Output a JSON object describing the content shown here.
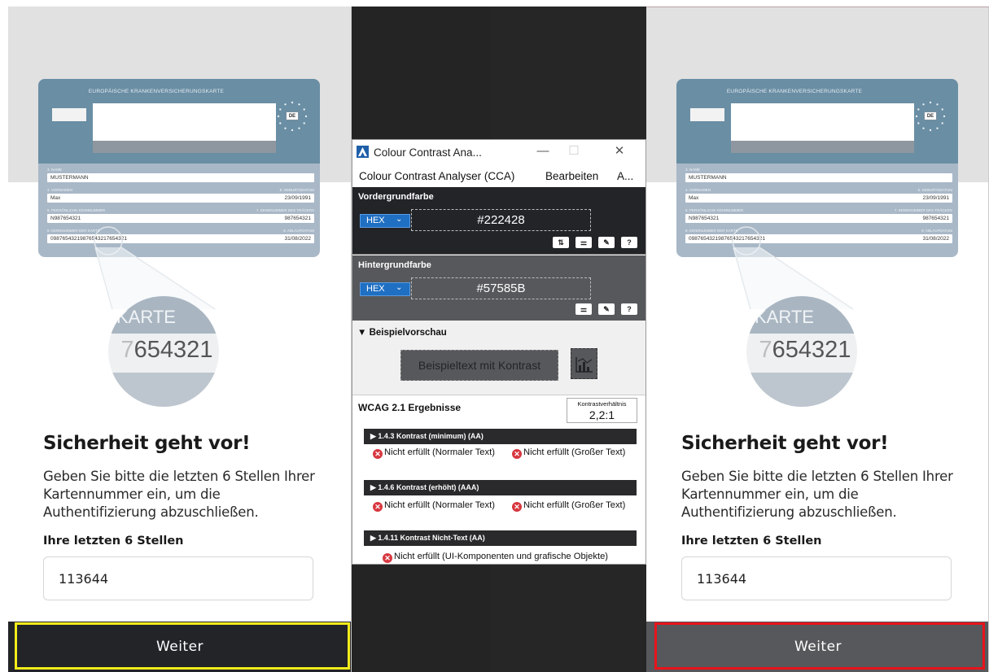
{
  "phone": {
    "card": {
      "header": "EUROPÄISCHE KRANKENVERSICHERUNGSKARTE",
      "country": "DE",
      "fields": [
        {
          "label": "3. NAME",
          "label_right": "",
          "value": "MUSTERMANN",
          "value_right": ""
        },
        {
          "label": "4. VORNAMEN",
          "label_right": "5. GEBURTSDATUM",
          "value": "Max",
          "value_right": "23/09/1991"
        },
        {
          "label": "6. PERSÖNLICHE KENNNUMMER",
          "label_right": "7. KENNNUMMER DES TRÄGERS",
          "value": "N987654321",
          "value_right": "987654321"
        },
        {
          "label": "8. KENNNUMMER DER KARTE",
          "label_right": "9. ABLAUFDATUM",
          "value": "09876543219876543217654321",
          "value_right": "31/08/2022"
        }
      ]
    },
    "magnifier": {
      "top_text": "KARTE",
      "number_faded": "7",
      "number": "654321"
    },
    "heading": "Sicherheit geht vor!",
    "description": "Geben Sie bitte die letzten 6 Stellen Ihrer Kartennummer ein, um die Authentifizierung abzuschließen.",
    "input_label": "Ihre letzten 6 Stellen",
    "input_value": "113644",
    "button_label": "Weiter"
  },
  "colors": {
    "left_button": "#222428",
    "right_button": "#57585B",
    "highlight_left": "#f2ec1b",
    "highlight_right": "#e8141b"
  },
  "cca": {
    "window_title": "Colour Contrast Ana...",
    "window_buttons": [
      "—",
      "☐",
      "✕"
    ],
    "menu": [
      "Colour Contrast Analyser (CCA)",
      "Bearbeiten",
      "A..."
    ],
    "foreground": {
      "title": "Vordergrundfarbe",
      "format": "HEX",
      "value": "#222428",
      "tools": [
        "swap-icon",
        "sliders-icon",
        "eyedropper-icon",
        "help-icon"
      ]
    },
    "background": {
      "title": "Hintergrundfarbe",
      "format": "HEX",
      "value": "#57585B",
      "tools": [
        "sliders-icon",
        "eyedropper-icon",
        "help-icon"
      ]
    },
    "preview": {
      "title": "▼ Beispielvorschau",
      "sample_text": "Beispieltext mit Kontrast"
    },
    "results": {
      "title": "WCAG 2.1 Ergebnisse",
      "ratio_label": "Kontrastverhältnis",
      "ratio_value": "2,2:1",
      "criteria": [
        {
          "title": "▶  1.4.3 Kontrast (minimum) (AA)",
          "r1": "Nicht erfüllt (Normaler Text)",
          "r2": "Nicht erfüllt (Großer Text)"
        },
        {
          "title": "▶  1.4.6 Kontrast (erhöht) (AAA)",
          "r1": "Nicht erfüllt (Normaler Text)",
          "r2": "Nicht erfüllt (Großer Text)"
        },
        {
          "title": "▶  1.4.11 Kontrast Nicht-Text (AA)",
          "r1": "Nicht erfüllt (UI-Komponenten und grafische Objekte)"
        }
      ]
    }
  }
}
